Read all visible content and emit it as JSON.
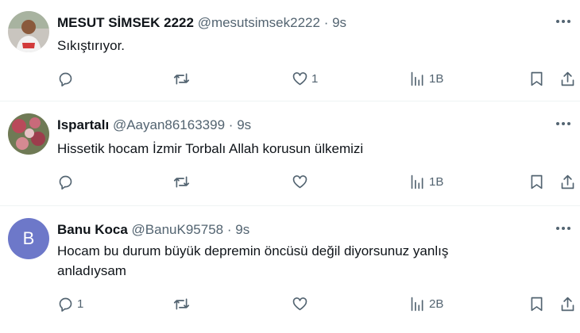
{
  "tweets": [
    {
      "name": "MESUT SİMSEK 2222",
      "handle": "@mesutsimsek2222",
      "separator": "·",
      "time": "9s",
      "text": "Sıkıştırıyor.",
      "avatar_icon": "user-photo-avatar",
      "counts": {
        "reply": "",
        "retweet": "",
        "like": "1",
        "views": "1B"
      }
    },
    {
      "name": "Ispartalı",
      "handle": "@Aayan86163399",
      "separator": "·",
      "time": "9s",
      "text": "Hissetik hocam İzmir Torbalı Allah korusun ülkemizi",
      "avatar_icon": "flower-photo-avatar",
      "counts": {
        "reply": "",
        "retweet": "",
        "like": "",
        "views": "1B"
      }
    },
    {
      "name": "Banu Koca",
      "handle": "@BanuK95758",
      "separator": "·",
      "time": "9s",
      "text_line1": "Hocam bu durum büyük depremin öncüsü değil  diyorsunuz yanlış",
      "text_line2": "anladıysam",
      "avatar_letter": "B",
      "avatar_color": "#6d78c9",
      "counts": {
        "reply": "1",
        "retweet": "",
        "like": "",
        "views": "2B"
      }
    }
  ],
  "icons": {
    "more": "more-dots-icon",
    "reply": "reply-bubble-icon",
    "retweet": "retweet-icon",
    "like": "heart-icon",
    "views": "views-bars-icon",
    "bookmark": "bookmark-icon",
    "share": "share-upload-icon"
  }
}
